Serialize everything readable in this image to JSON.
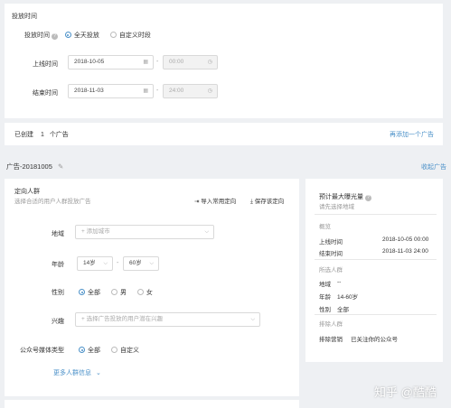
{
  "schedule": {
    "title": "投放时间",
    "mode_label": "投放时间",
    "opt_all": "全天投放",
    "opt_custom": "自定义时段",
    "start_label": "上线时间",
    "start_date": "2018-10-05",
    "start_time": "00:00",
    "end_label": "结束时间",
    "end_date": "2018-11-03",
    "end_time": "24:00",
    "dash": "-"
  },
  "created_bar": {
    "prefix": "已创建",
    "count": "1",
    "suffix": "个广告",
    "add_link": "再添加一个广告"
  },
  "ad": {
    "name": "广告-20181005",
    "collapse_link": "收起广告"
  },
  "targeting": {
    "title": "定向人群",
    "subtitle": "选择合适的用户人群投放广告",
    "import_label": "导入常用定向",
    "save_label": "保存该定向",
    "region_label": "地域",
    "region_placeholder": "+ 添加城市",
    "age_label": "年龄",
    "age_min": "14岁",
    "age_max": "60岁",
    "age_dash": "-",
    "gender_label": "性别",
    "gender_all": "全部",
    "gender_male": "男",
    "gender_female": "女",
    "interest_label": "兴趣",
    "interest_placeholder": "+ 选择广告投放的用户潜在兴趣",
    "media_label": "公众号媒体类型",
    "media_all": "全部",
    "media_custom": "自定义",
    "more_link": "更多人群信息"
  },
  "summary": {
    "title": "预计最大曝光量",
    "hint": "请先选择地域",
    "overview": "概览",
    "start_label": "上线时间",
    "start_value": "2018-10-05 00:00",
    "end_label": "结束时间",
    "end_value": "2018-11-03 24:00",
    "audience_title": "所选人群",
    "region_label": "地域",
    "region_value": "--",
    "age_label": "年龄",
    "age_value": "14-60岁",
    "gender_label": "性别",
    "gender_value": "全部",
    "exclude_title": "排除人群",
    "exclude_label": "排除营销",
    "exclude_value": "已关注你的公众号"
  },
  "watermark": "知乎 @酷酷"
}
